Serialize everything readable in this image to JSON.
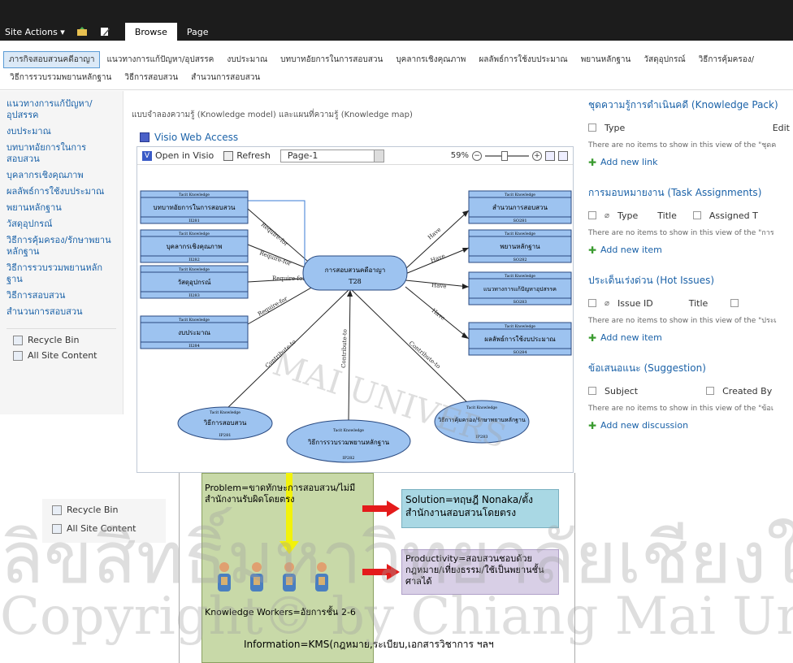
{
  "ribbon": {
    "site_actions": "Site Actions ▾",
    "tabs": [
      "Browse",
      "Page"
    ]
  },
  "topnav": {
    "row1": [
      "ภารกิจสอบสวนคดีอาญา",
      "แนวทางการแก้ปัญหา/อุปสรรค",
      "งบประมาณ",
      "บทบาทอัยการในการสอบสวน",
      "บุคลากรเชิงคุณภาพ",
      "ผลลัพธ์การใช้งบประมาณ",
      "พยานหลักฐาน",
      "วัสดุอุปกรณ์",
      "วิธีการคุ้มครอง/"
    ],
    "row2": [
      "วิธีการรวบรวมพยานหลักฐาน",
      "วิธีการสอบสวน",
      "สำนวนการสอบสวน"
    ]
  },
  "quicklaunch": {
    "items": [
      "แนวทางการแก้ปัญหา/อุปสรรค",
      "งบประมาณ",
      "บทบาทอัยการในการสอบสวน",
      "บุคลากรเชิงคุณภาพ",
      "ผลลัพธ์การใช้งบประมาณ",
      "พยานหลักฐาน",
      "วัสดุอุปกรณ์",
      "วิธีการคุ้มครอง/รักษาพยานหลักฐาน",
      "วิธีการรวบรวมพยานหลักฐาน",
      "วิธีการสอบสวน",
      "สำนวนการสอบสวน"
    ],
    "recycle_bin": "Recycle Bin",
    "all_site_content": "All Site Content"
  },
  "main": {
    "description": "แบบจำลองความรู้ (Knowledge model) และแผนที่ความรู้ (Knowledge map)",
    "webpart_title": "Visio Web Access"
  },
  "visio": {
    "open_in_visio": "Open in Visio",
    "refresh": "Refresh",
    "page": "Page-1",
    "zoom": "59%",
    "center": {
      "title": "การสอบสวนคดีอาญา",
      "code": "T28"
    },
    "left_boxes": [
      {
        "head": "Tacit Knowledge",
        "title": "บทบาทอัยการในการสอบสวน",
        "code": "II281",
        "edge": "Require-for"
      },
      {
        "head": "Tacit Knowledge",
        "title": "บุคลากรเชิงคุณภาพ",
        "code": "II282",
        "edge": "Require-for"
      },
      {
        "head": "Tacit Knowledge",
        "title": "วัสดุอุปกรณ์",
        "code": "II283",
        "edge": "Require-for"
      },
      {
        "head": "Tacit Knowledge",
        "title": "งบประมาณ",
        "code": "II284",
        "edge": "Require-for"
      }
    ],
    "right_boxes": [
      {
        "head": "Tacit Knowledge",
        "title": "สำนวนการสอบสวน",
        "code": "SO281",
        "edge": "Have"
      },
      {
        "head": "Tacit Knowledge",
        "title": "พยานหลักฐาน",
        "code": "SO282",
        "edge": "Have"
      },
      {
        "head": "Tacit Knowledge",
        "title": "แนวทางการแก้ปัญหาอุปสรรค",
        "code": "SO283",
        "edge": "Have"
      },
      {
        "head": "Tacit Knowledge",
        "title": "ผลลัพธ์การใช้งบประมาณ",
        "code": "SO284",
        "edge": "Have"
      }
    ],
    "bottom_ellipses": [
      {
        "head": "Tacit Knowledge",
        "title": "วิธีการสอบสวน",
        "code": "IP281",
        "edge": "Contribute-to"
      },
      {
        "head": "Tacit Knowledge",
        "title": "วิธีการรวบรวมพยานหลักฐาน",
        "code": "IP282",
        "edge": "Contribute-to"
      },
      {
        "head": "Tacit Knowledge",
        "title": "วิธีการคุ้มครอง/รักษาพยานหลักฐาน",
        "code": "IP283",
        "edge": "Contribute-to"
      }
    ]
  },
  "right_panel": [
    {
      "title": "ชุดความรู้การดำเนินคดี (Knowledge Pack)",
      "cols": [
        "Type",
        "Edit"
      ],
      "empty": "There are no items to show in this view of the \"ชุดค",
      "add": "Add new link"
    },
    {
      "title": "การมอบหมายงาน (Task Assignments)",
      "cols": [
        "Type",
        "Title",
        "Assigned T"
      ],
      "empty": "There are no items to show in this view of the \"การ",
      "add": "Add new item"
    },
    {
      "title": "ประเด็นเร่งด่วน (Hot Issues)",
      "cols": [
        "Issue ID",
        "Title"
      ],
      "empty": "There are no items to show in this view of the \"ประเ",
      "add": "Add new item"
    },
    {
      "title": "ข้อเสนอแนะ (Suggestion)",
      "cols": [
        "Subject",
        "Created By"
      ],
      "empty": "There are no items to show in this view of the \"ข้อเ",
      "add": "Add new discussion"
    }
  ],
  "lower": {
    "problem": "Problem=ขาดทักษะการสอบสวน/ไม่มีสำนักงานรับผิดโดยตรง",
    "solution": "Solution=ทฤษฎี Nonaka/ตั้งสำนักงานสอบสวนโดยตรง",
    "productivity": "Productivity=สอบสวนชอบด้วยกฎหมาย/เที่ยงธรรม/ใช้เป็นพยานชั้นศาลได้",
    "workers": "Knowledge Workers=อัยการชั้น 2-6",
    "information": "Information=KMS(กฎหมาย,ระเบียบ,เอกสารวิชาการ ฯลฯ",
    "recycle_bin": "Recycle Bin",
    "all_site_content": "All Site Content"
  },
  "watermark": {
    "line1": "ลิขสิทธิ์มหาวิทยาลัยเชียงใหม่",
    "line2": "Copyright© by Chiang Mai University",
    "seal": "MAI UNIVERS"
  }
}
